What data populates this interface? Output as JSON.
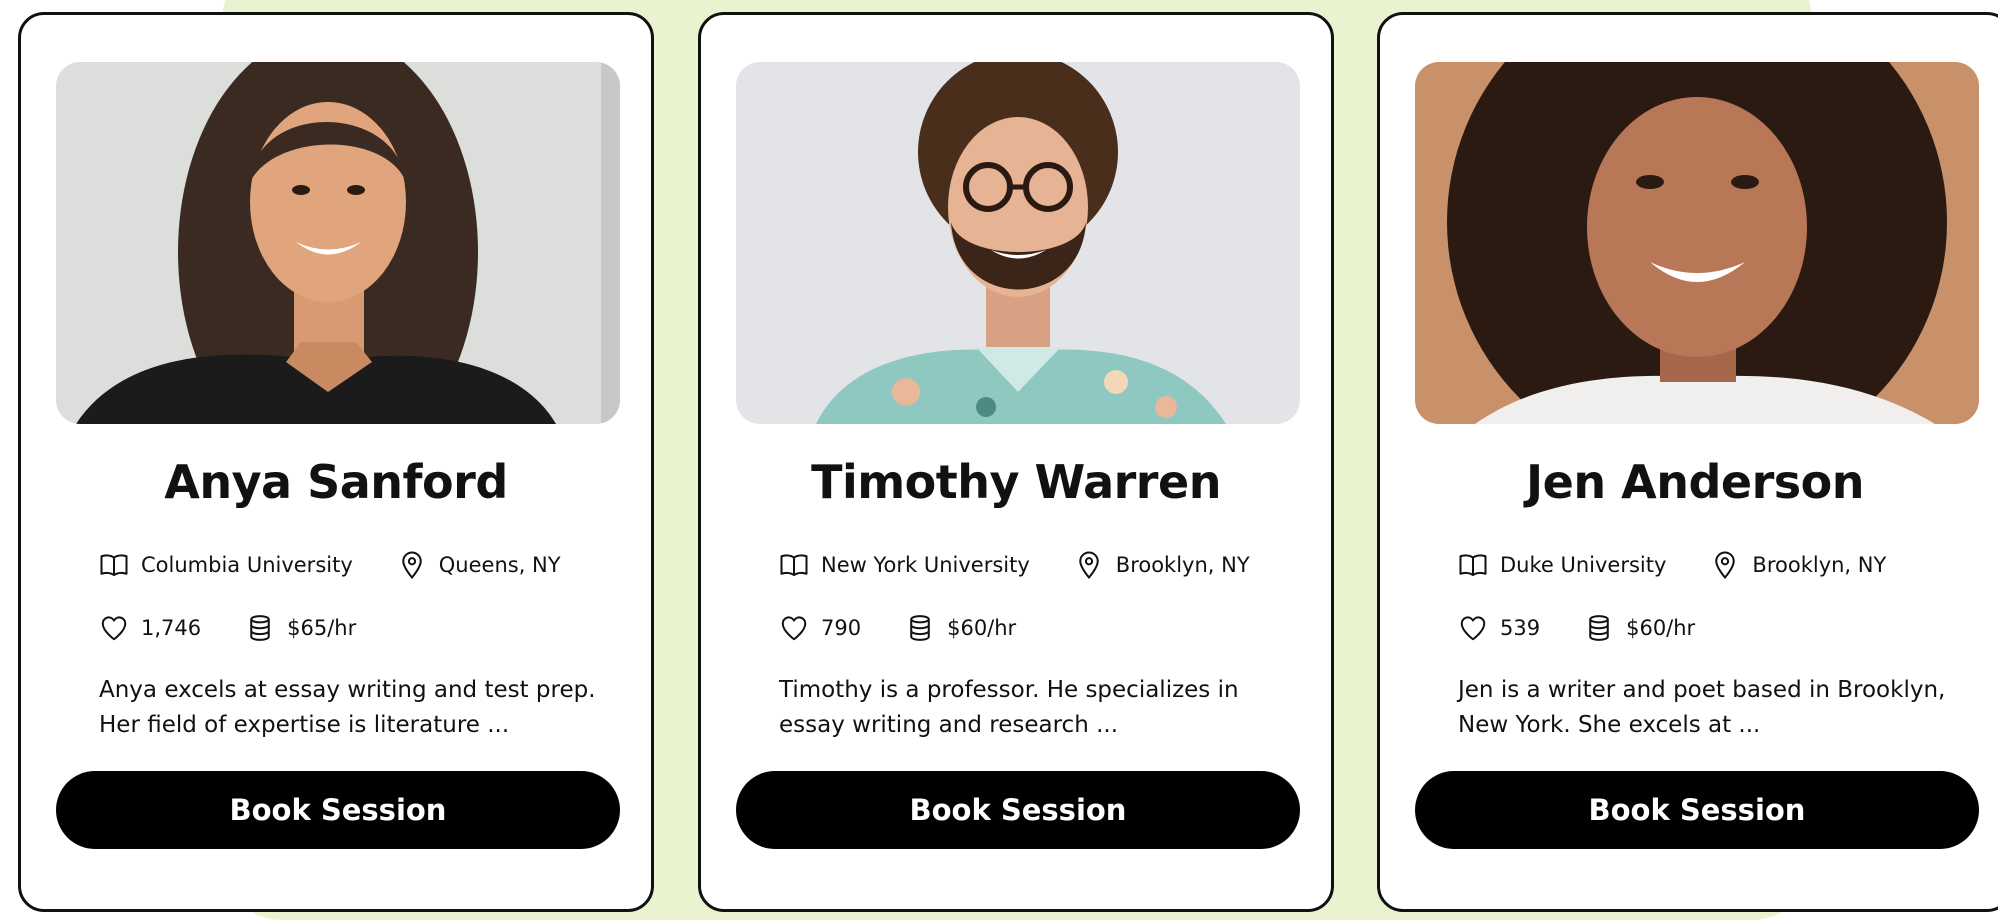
{
  "tutors": [
    {
      "name": "Anya Sanford",
      "school": "Columbia University",
      "location": "Queens, NY",
      "likes": "1,746",
      "rate": "$65/hr",
      "description": "Anya excels at essay writing and test prep. Her field of expertise is literature ...",
      "button_label": "Book Session"
    },
    {
      "name": "Timothy Warren",
      "school": "New York University",
      "location": "Brooklyn, NY",
      "likes": "790",
      "rate": "$60/hr",
      "description": "Timothy is a professor. He specializes in essay writing and research ...",
      "button_label": "Book Session"
    },
    {
      "name": "Jen Anderson",
      "school": "Duke University",
      "location": "Brooklyn, NY",
      "likes": "539",
      "rate": "$60/hr",
      "description": "Jen is a writer and poet based in Brooklyn, New York. She excels at ...",
      "button_label": "Book Session"
    }
  ],
  "icons": [
    "book-icon",
    "location-pin-icon",
    "heart-icon",
    "coins-icon"
  ],
  "colors": {
    "background_accent": "#eaf3cf",
    "button": "#000000",
    "card_border": "#111111"
  }
}
